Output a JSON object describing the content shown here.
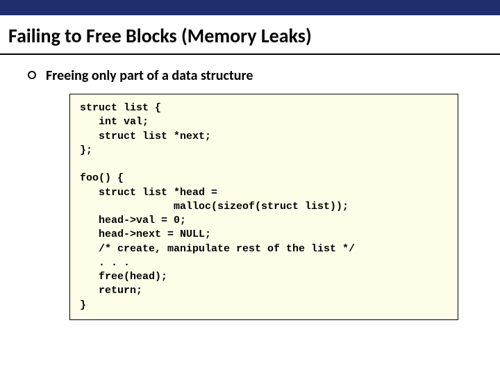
{
  "slide": {
    "title": "Failing to Free Blocks (Memory Leaks)",
    "bullet_text": "Freeing only part of a data structure",
    "code": "struct list {\n   int val;\n   struct list *next;\n};\n\nfoo() {\n   struct list *head =\n               malloc(sizeof(struct list));\n   head->val = 0;\n   head->next = NULL;\n   /* create, manipulate rest of the list */\n   . . .\n   free(head);\n   return;\n}"
  }
}
